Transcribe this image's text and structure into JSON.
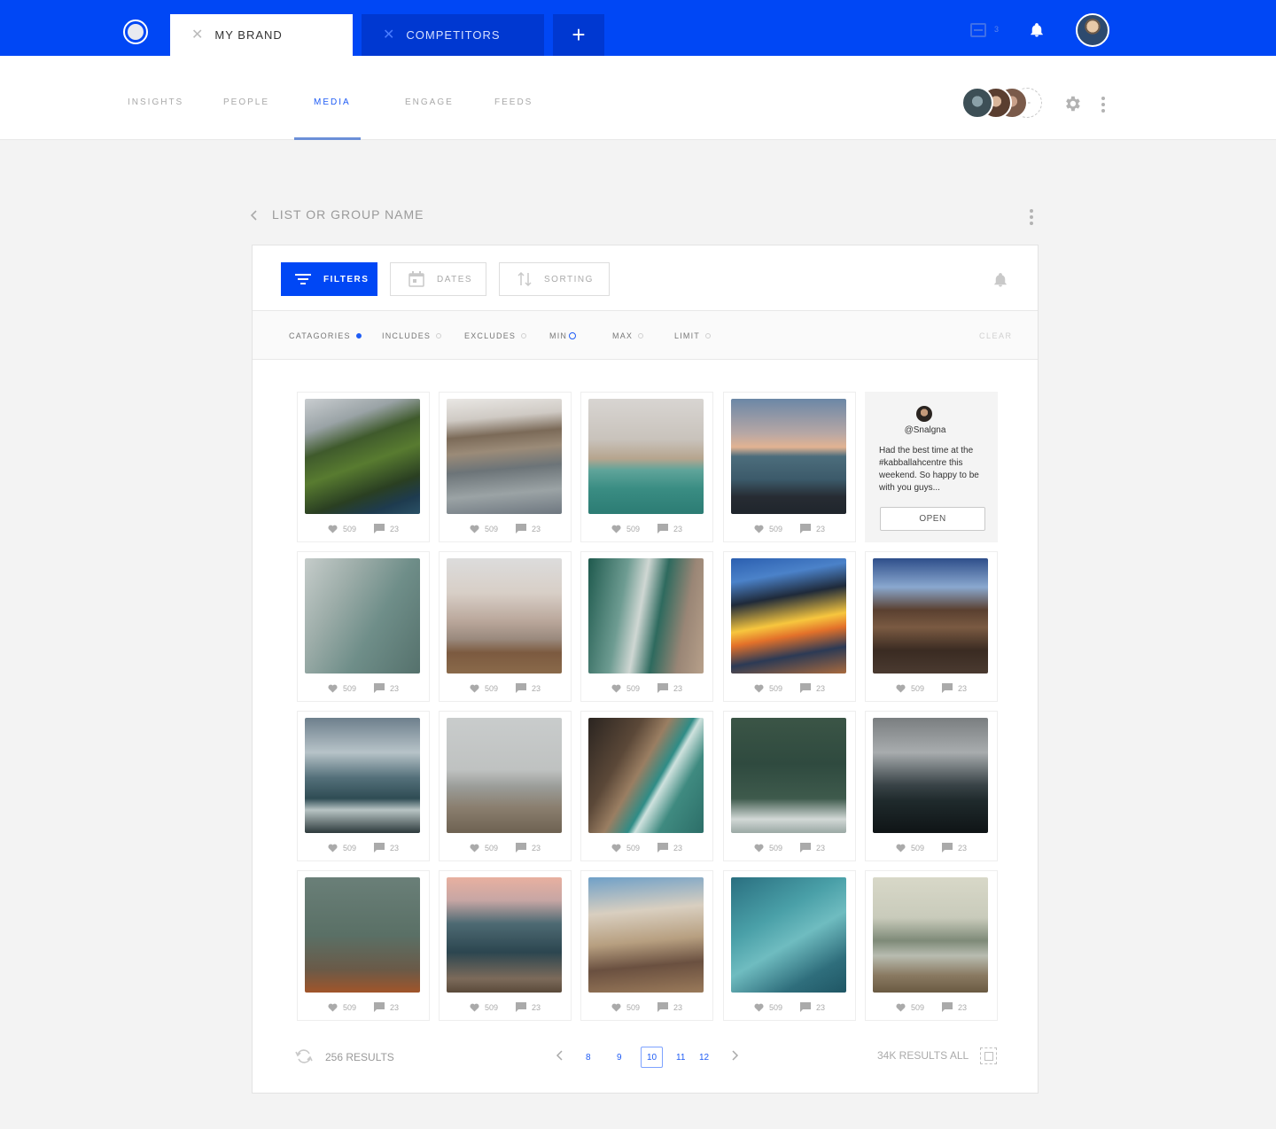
{
  "topbar": {
    "tabs": [
      {
        "label": "MY BRAND",
        "close": "✕"
      },
      {
        "label": "COMPETITORS",
        "close": "✕"
      }
    ],
    "add_tab": "+",
    "inbox_count": "3"
  },
  "nav": {
    "items": [
      "INSIGHTS",
      "PEOPLE",
      "MEDIA",
      "ENGAGE",
      "FEEDS"
    ],
    "active": "MEDIA",
    "add_member": "+"
  },
  "breadcrumb": {
    "title": "LIST OR GROUP NAME"
  },
  "toolbar": {
    "filters_label": "FILTERS",
    "dates_label": "DATES",
    "sorting_label": "SORTING"
  },
  "filters": {
    "items": [
      "CATAGORIES",
      "INCLUDES",
      "EXCLUDES",
      "MIN",
      "MAX",
      "LIMIT"
    ],
    "clear_label": "CLEAR"
  },
  "media": {
    "likes": "509",
    "comments": "23",
    "text_post": {
      "handle": "@Snalgna",
      "text": "Had the best time at the #kabballahcentre this weekend. So happy to be with you guys...",
      "open_label": "OPEN"
    }
  },
  "footer": {
    "results": "256 RESULTS",
    "pages": [
      "8",
      "9",
      "10",
      "11",
      "12"
    ],
    "current_page": "10",
    "results_all": "34K RESULTS ALL"
  },
  "colors": {
    "brand": "#0047f5",
    "accent": "#1f5cf5",
    "background": "#f3f3f3"
  }
}
